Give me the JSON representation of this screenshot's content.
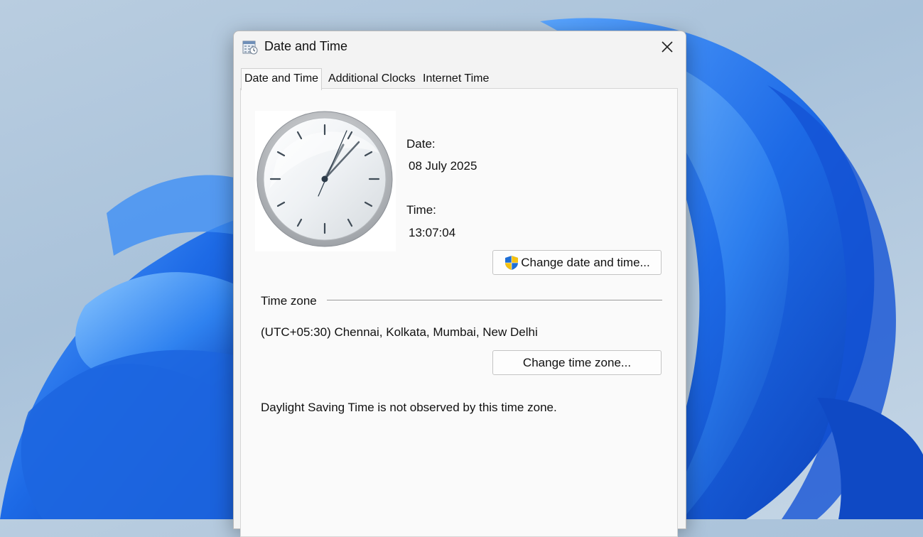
{
  "window": {
    "title": "Date and Time",
    "close_icon": "close-icon"
  },
  "tabs": [
    {
      "label": "Date and Time",
      "active": true
    },
    {
      "label": "Additional Clocks",
      "active": false
    },
    {
      "label": "Internet Time",
      "active": false
    }
  ],
  "date_time_tab": {
    "date_label": "Date:",
    "date_value": "08 July 2025",
    "time_label": "Time:",
    "time_value": "13:07:04",
    "change_datetime_button": "Change date and time...",
    "change_datetime_icon": "uac-shield-icon",
    "timezone_heading": "Time zone",
    "timezone_value": "(UTC+05:30) Chennai, Kolkata, Mumbai, New Delhi",
    "change_timezone_button": "Change time zone...",
    "dst_note": "Daylight Saving Time is not observed by this time zone."
  },
  "colors": {
    "annotation_arrow": "#f0443a",
    "wallpaper_accent": "#1a6fe0"
  }
}
